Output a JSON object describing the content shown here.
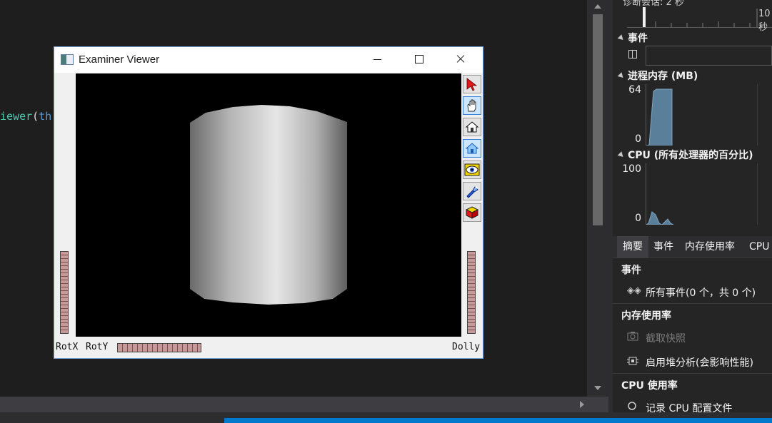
{
  "editor": {
    "code_fragment": {
      "name": "iewer",
      "paren": "(",
      "kw": "th"
    }
  },
  "viewer": {
    "title": "Examiner Viewer",
    "labels": {
      "rotx": "RotX",
      "roty": "RotY",
      "dolly": "Dolly"
    },
    "toolbar": [
      "select-arrow-icon",
      "hand-view-icon",
      "home-icon",
      "set-home-icon",
      "view-all-eye-icon",
      "seek-flashlight-icon",
      "projection-cube-icon"
    ]
  },
  "diagnostics": {
    "timeline_caption": "诊断会话: 2 秒",
    "timeline_label": "10秒",
    "events": {
      "title": "事件"
    },
    "memory": {
      "title": "进程内存 (MB)",
      "ymax": "64",
      "ymin": "0"
    },
    "cpu": {
      "title": "CPU (所有处理器的百分比)",
      "ymax": "100",
      "ymin": "0"
    },
    "tabs": [
      "摘要",
      "事件",
      "内存使用率",
      "CPU"
    ],
    "summary": {
      "events_heading": "事件",
      "all_events": "所有事件(0 个，共 0 个)",
      "memory_heading": "内存使用率",
      "snapshot": "截取快照",
      "heap_profiling": "启用堆分析(会影响性能)",
      "cpu_heading": "CPU 使用率",
      "record_cpu": "记录 CPU 配置文件"
    }
  },
  "colors": {
    "accent": "#007acc",
    "graph_fill": "#5a7f9a"
  }
}
